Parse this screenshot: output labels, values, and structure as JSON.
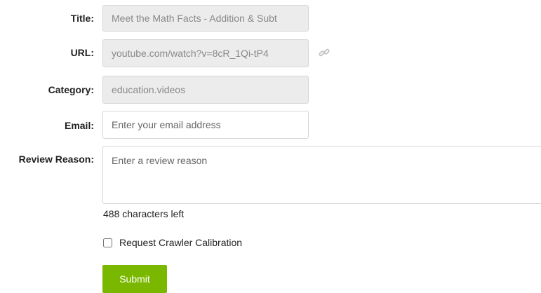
{
  "form": {
    "title": {
      "label": "Title:",
      "value": "Meet the Math Facts - Addition & Subt"
    },
    "url": {
      "label": "URL:",
      "value": "youtube.com/watch?v=8cR_1Qi-tP4",
      "icon": "link-icon"
    },
    "category": {
      "label": "Category:",
      "value": "education.videos"
    },
    "email": {
      "label": "Email:",
      "value": "",
      "placeholder": "Enter your email address"
    },
    "review_reason": {
      "label": "Review Reason:",
      "value": "",
      "placeholder": "Enter a review reason"
    },
    "chars_left": "488 characters left",
    "crawler_calibration": {
      "label": "Request Crawler Calibration",
      "checked": false
    },
    "submit_label": "Submit"
  },
  "colors": {
    "submit_bg": "#7ab800",
    "readonly_bg": "#ececec",
    "border": "#d6d6d6"
  }
}
